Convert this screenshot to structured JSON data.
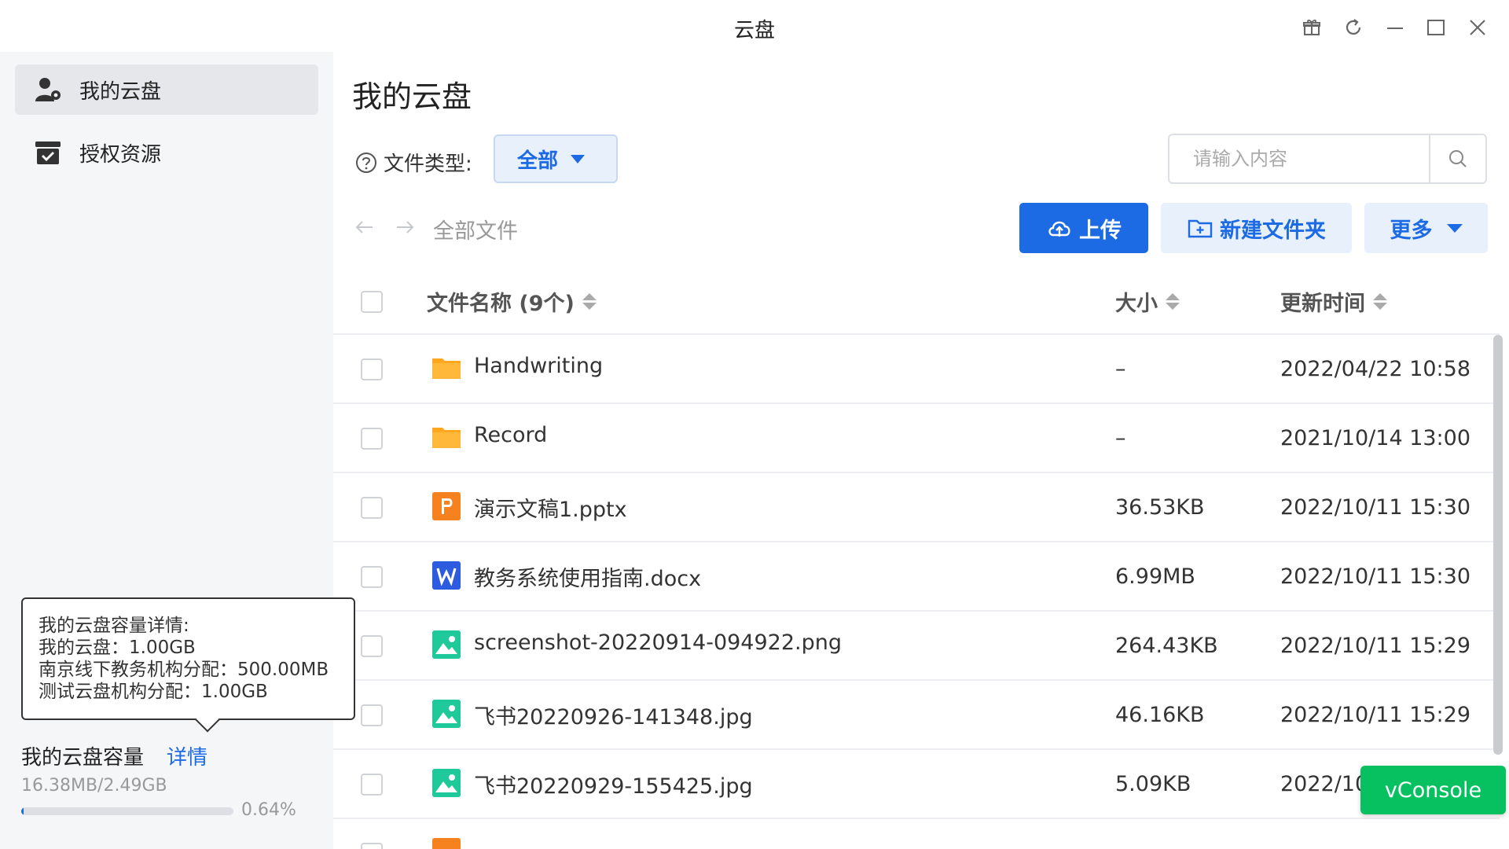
{
  "window": {
    "title": "云盘",
    "controls": [
      "gift-icon",
      "refresh-icon",
      "minimize-icon",
      "maximize-icon",
      "close-icon"
    ]
  },
  "sidebar": {
    "items": [
      {
        "label": "我的云盘",
        "icon": "user-icon",
        "active": true
      },
      {
        "label": "授权资源",
        "icon": "authorized-box-icon",
        "active": false
      }
    ],
    "tooltip": {
      "title": "我的云盘容量详情:",
      "lines": [
        "我的云盘：1.00GB",
        "南京线下教务机构分配：500.00MB",
        "测试云盘机构分配：1.00GB"
      ]
    },
    "capacity": {
      "title": "我的云盘容量",
      "detail_link": "详情",
      "used": "16.38MB/2.49GB",
      "percent_text": "0.64%",
      "percent": 0.64
    }
  },
  "main": {
    "title": "我的云盘",
    "filter": {
      "label": "文件类型:",
      "selected": "全部"
    },
    "search": {
      "placeholder": "请输入内容"
    },
    "breadcrumb": "全部文件",
    "buttons": {
      "upload": "上传",
      "new_folder": "新建文件夹",
      "more": "更多"
    },
    "table": {
      "headers": {
        "name": "文件名称 (9个)",
        "size": "大小",
        "time": "更新时间"
      },
      "rows": [
        {
          "icon": "folder-icon",
          "name": "Handwriting",
          "size": "–",
          "time": "2022/04/22 10:58"
        },
        {
          "icon": "folder-icon",
          "name": "Record",
          "size": "–",
          "time": "2021/10/14 13:00"
        },
        {
          "icon": "pptx-file-icon",
          "name": "演示文稿1.pptx",
          "size": "36.53KB",
          "time": "2022/10/11 15:30"
        },
        {
          "icon": "docx-file-icon",
          "name": "教务系统使用指南.docx",
          "size": "6.99MB",
          "time": "2022/10/11 15:30"
        },
        {
          "icon": "image-file-icon",
          "name": "screenshot-20220914-094922.png",
          "size": "264.43KB",
          "time": "2022/10/11 15:29"
        },
        {
          "icon": "image-file-icon",
          "name": "飞书20220926-141348.jpg",
          "size": "46.16KB",
          "time": "2022/10/11 15:29"
        },
        {
          "icon": "image-file-icon",
          "name": "飞书20220929-155425.jpg",
          "size": "5.09KB",
          "time": "2022/10"
        }
      ]
    }
  },
  "overlay": {
    "vconsole": "vConsole"
  },
  "colors": {
    "accent": "#1d6ae5",
    "folder": "#ffa81f",
    "pptx": "#f5821f",
    "docx": "#2c5be0",
    "image": "#1fc99a",
    "vconsole": "#07c160"
  }
}
